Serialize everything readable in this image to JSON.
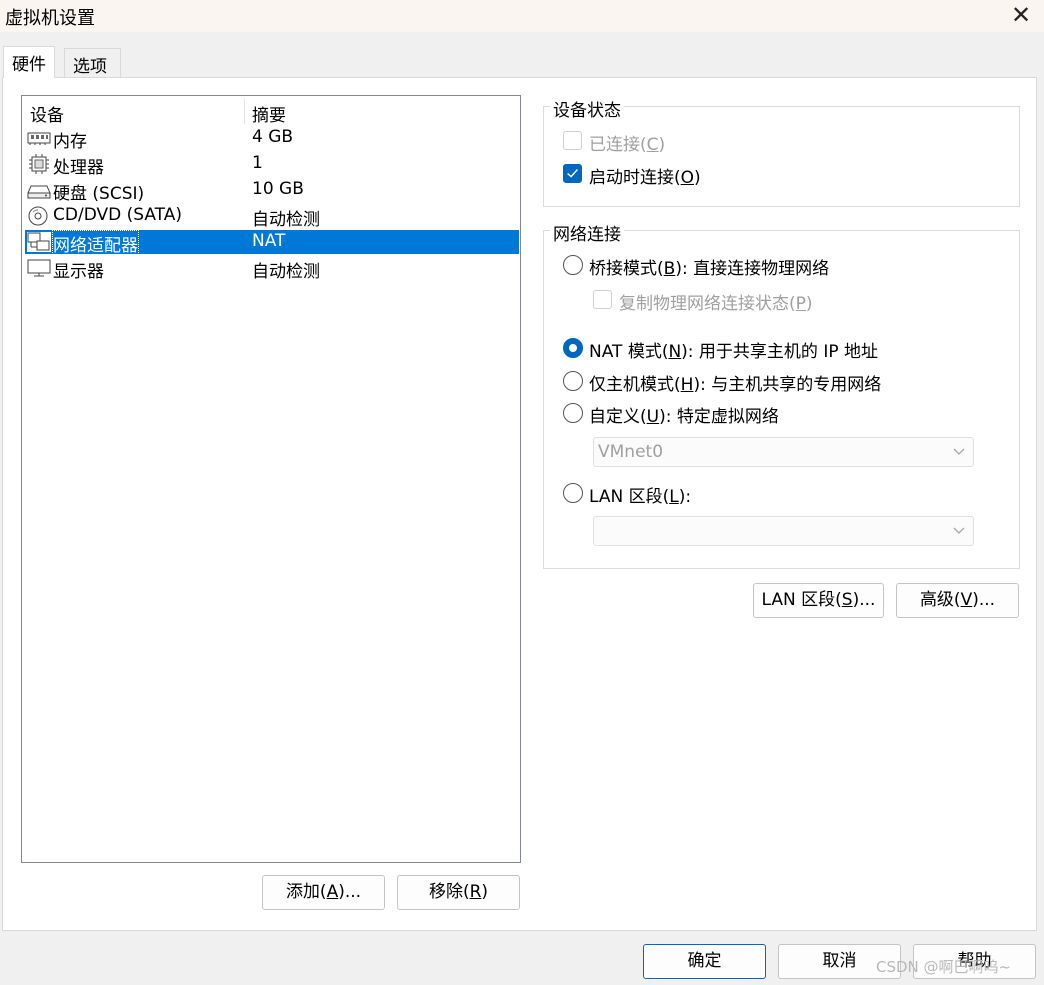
{
  "window": {
    "title": "虚拟机设置",
    "close_glyph": "✕"
  },
  "tabs": [
    {
      "label": "硬件"
    },
    {
      "label": "选项"
    }
  ],
  "device_list": {
    "col_device": "设备",
    "col_summary": "摘要",
    "rows": [
      {
        "icon": "memory-icon",
        "name": "内存",
        "summary": "4 GB"
      },
      {
        "icon": "processor-icon",
        "name": "处理器",
        "summary": "1"
      },
      {
        "icon": "hard-disk-icon",
        "name": "硬盘 (SCSI)",
        "summary": "10 GB"
      },
      {
        "icon": "cd-dvd-icon",
        "name": "CD/DVD (SATA)",
        "summary": "自动检测"
      },
      {
        "icon": "network-adapter-icon",
        "name": "网络适配器",
        "summary": "NAT",
        "selected": true
      },
      {
        "icon": "display-icon",
        "name": "显示器",
        "summary": "自动检测"
      }
    ]
  },
  "left_buttons": {
    "add": {
      "text": "添加(",
      "key": "A",
      "suffix": ")..."
    },
    "remove": {
      "text": "移除(",
      "key": "R",
      "suffix": ")"
    }
  },
  "device_status": {
    "title": "设备状态",
    "connected": {
      "text": "已连接(",
      "key": "C",
      "suffix": ")",
      "checked": false,
      "enabled": false
    },
    "connect_at_power_on": {
      "text": "启动时连接(",
      "key": "O",
      "suffix": ")",
      "checked": true,
      "enabled": true
    }
  },
  "network_connection": {
    "title": "网络连接",
    "bridged": {
      "text": "桥接模式(",
      "key": "B",
      "suffix": "): 直接连接物理网络",
      "selected": false
    },
    "replicate": {
      "text": "复制物理网络连接状态(",
      "key": "P",
      "suffix": ")",
      "checked": false,
      "enabled": false
    },
    "nat": {
      "text": "NAT 模式(",
      "key": "N",
      "suffix": "): 用于共享主机的 IP 地址",
      "selected": true
    },
    "host_only": {
      "text": "仅主机模式(",
      "key": "H",
      "suffix": "): 与主机共享的专用网络",
      "selected": false
    },
    "custom": {
      "text": "自定义(",
      "key": "U",
      "suffix": "): 特定虚拟网络",
      "selected": false
    },
    "custom_value": "VMnet0",
    "lan_segment": {
      "text": "LAN 区段(",
      "key": "L",
      "suffix": "):",
      "selected": false
    },
    "lan_value": ""
  },
  "right_buttons": {
    "lan_segments": {
      "text": "LAN 区段(",
      "key": "S",
      "suffix": ")..."
    },
    "advanced": {
      "text": "高级(",
      "key": "V",
      "suffix": ")..."
    }
  },
  "footer": {
    "ok": "确定",
    "cancel": "取消",
    "help": "帮助"
  },
  "watermark": "CSDN @啊巴啊呜~",
  "colors": {
    "accent": "#0067c0",
    "selection": "#0078d7"
  }
}
